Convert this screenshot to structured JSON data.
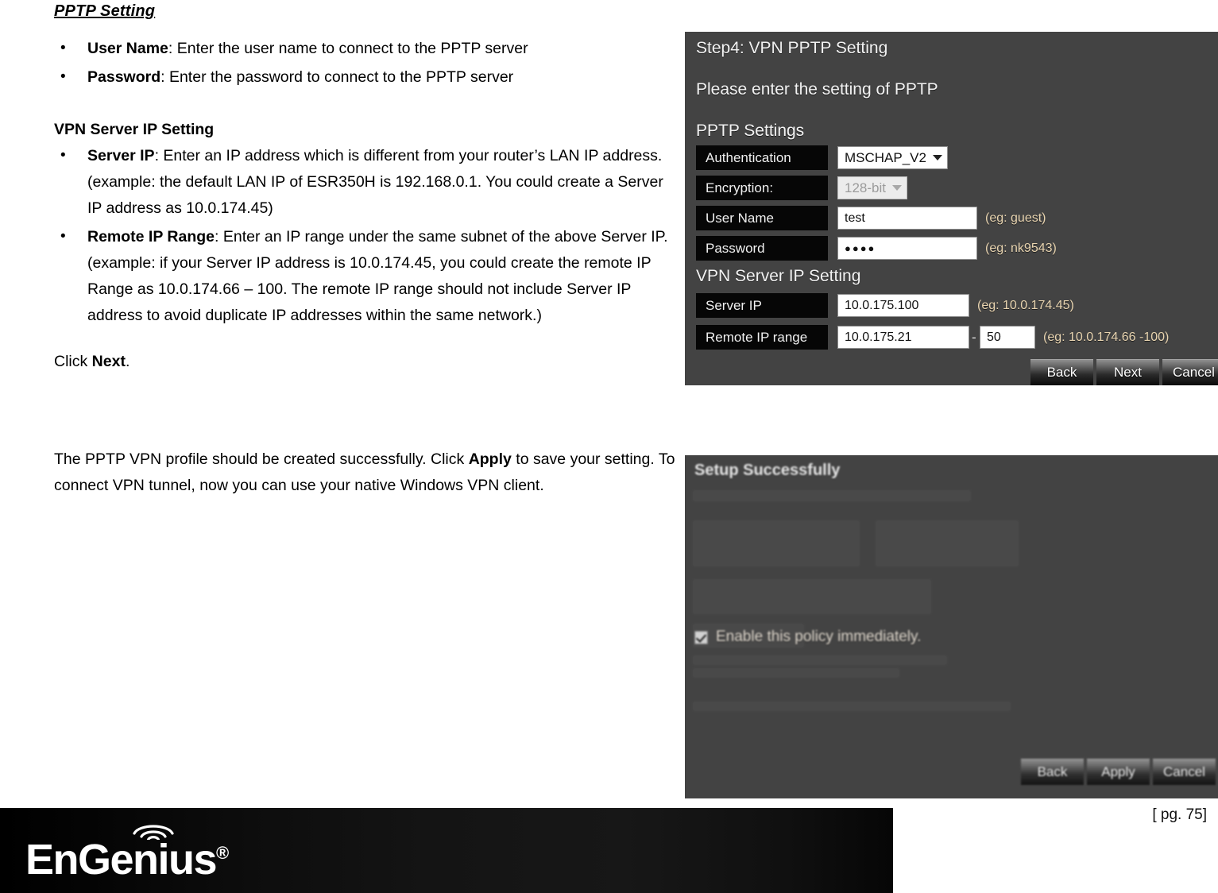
{
  "document": {
    "section_title": "PPTP Setting",
    "bullets_top": [
      {
        "term": "User Name",
        "text": ": Enter the user name to connect to the PPTP server"
      },
      {
        "term": "Password",
        "text": ": Enter the password to connect to the PPTP server"
      }
    ],
    "subheading": "VPN Server IP Setting",
    "bullets_mid": [
      {
        "term": "Server IP",
        "text": ": Enter an IP address which is different from your router’s LAN IP address. (example: the default LAN IP of ESR350H is 192.168.0.1. You could create a Server IP address as 10.0.174.45)"
      },
      {
        "term": "Remote IP Range",
        "text": ": Enter an IP range under the same subnet of the above Server IP. (example: if  your Server IP address is 10.0.174.45, you could create the remote IP Range as 10.0.174.66 – 100. The remote IP range should not include Server IP address to avoid duplicate IP addresses within the same network.)"
      }
    ],
    "click_next_pre": "Click ",
    "click_next_bold": "Next",
    "click_next_post": ".",
    "apply_para_1": "The PPTP VPN profile should be created successfully. Click ",
    "apply_para_bold": "Apply",
    "apply_para_2": " to save your setting. To connect VPN tunnel, now you can use your native Windows VPN client."
  },
  "screenshot_pptp": {
    "title": "Step4: VPN PPTP Setting",
    "subtitle": "Please enter the setting of PPTP",
    "group_pptp": "PPTP Settings",
    "group_vpn": "VPN Server IP Setting",
    "rows": {
      "authentication": {
        "label": "Authentication",
        "value": "MSCHAP_V2"
      },
      "encryption": {
        "label": "Encryption:",
        "value": "128-bit"
      },
      "username": {
        "label": "User Name",
        "value": "test",
        "hint": "(eg: guest)"
      },
      "password": {
        "label": "Password",
        "value": "●●●●",
        "hint": "(eg: nk9543)"
      },
      "server_ip": {
        "label": "Server IP",
        "value": "10.0.175.100",
        "hint": "(eg: 10.0.174.45)"
      },
      "remote_ip_range": {
        "label": "Remote IP range",
        "value_start": "10.0.175.21",
        "separator": "-",
        "value_end": "50",
        "hint": "(eg: 10.0.174.66 -100)"
      }
    },
    "buttons": {
      "back": "Back",
      "next": "Next",
      "cancel": "Cancel"
    }
  },
  "screenshot_success": {
    "title": "Setup Successfully",
    "checkbox_label": "Enable this policy immediately.",
    "checkbox_checked": true,
    "buttons": {
      "back": "Back",
      "apply": "Apply",
      "cancel": "Cancel"
    }
  },
  "footer": {
    "logo_text": "EnGenius",
    "logo_reg": "®",
    "page_label": "[ pg. 75]"
  },
  "colors": {
    "panel_bg": "#434343",
    "label_bg": "#060606",
    "hint_text": "#e8d4b0",
    "field_bg": "#ffffff",
    "footer_bg": "#111111"
  }
}
